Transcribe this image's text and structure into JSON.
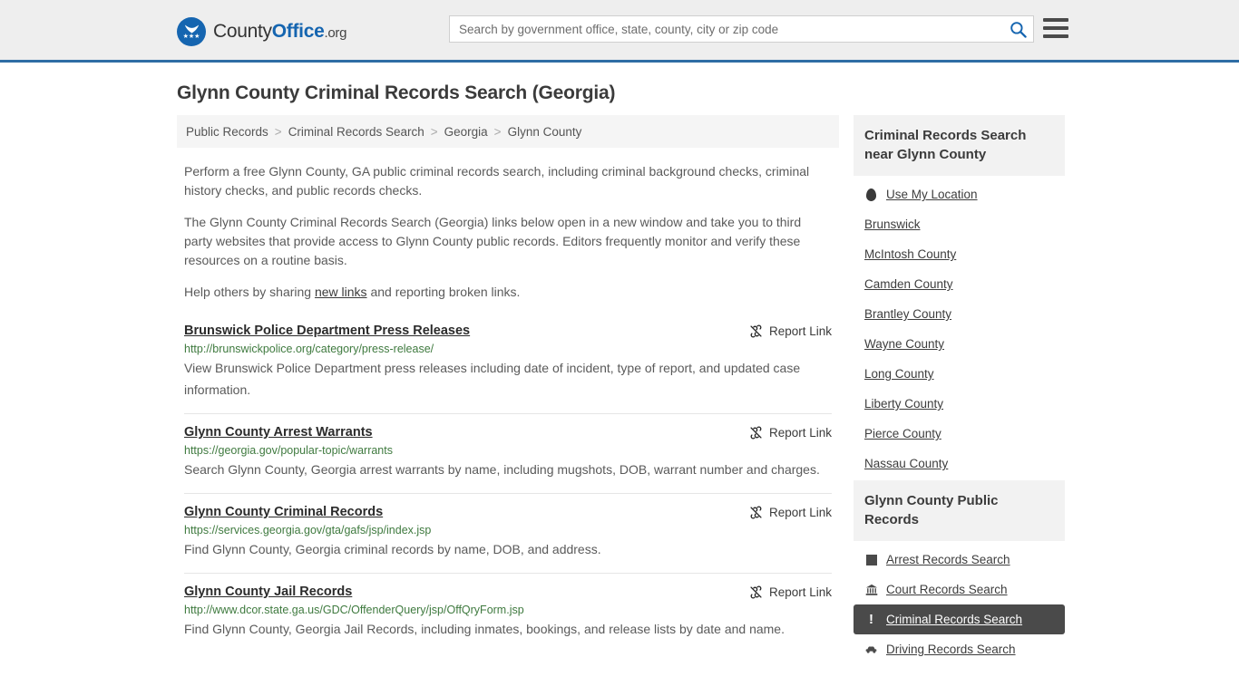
{
  "header": {
    "brand": {
      "part1": "County",
      "part2": "Office",
      "tld": ".org"
    },
    "search": {
      "placeholder": "Search by government office, state, county, city or zip code",
      "value": "",
      "button_label": "Search"
    },
    "menu_label": "Menu",
    "accent_color": "#2e6da4",
    "background_color": "#eeeeee"
  },
  "page": {
    "title": "Glynn County Criminal Records Search (Georgia)"
  },
  "breadcrumb": {
    "separator": ">",
    "items": [
      {
        "label": "Public Records"
      },
      {
        "label": "Criminal Records Search"
      },
      {
        "label": "Georgia"
      },
      {
        "label": "Glynn County"
      }
    ]
  },
  "intro": {
    "paragraph1": "Perform a free Glynn County, GA public criminal records search, including criminal background checks, criminal history checks, and public records checks.",
    "paragraph2": "The Glynn County Criminal Records Search (Georgia) links below open in a new window and take you to third party websites that provide access to Glynn County public records. Editors frequently monitor and verify these resources on a routine basis.",
    "paragraph3_before": "Help others by sharing ",
    "paragraph3_link": "new links",
    "paragraph3_after": " and reporting broken links."
  },
  "report_link_label": "Report Link",
  "records": [
    {
      "title": "Brunswick Police Department Press Releases",
      "url": "http://brunswickpolice.org/category/press-release/",
      "description": "View Brunswick Police Department press releases including date of incident, type of report, and updated case information."
    },
    {
      "title": "Glynn County Arrest Warrants",
      "url": "https://georgia.gov/popular-topic/warrants",
      "description": "Search Glynn County, Georgia arrest warrants by name, including mugshots, DOB, warrant number and charges."
    },
    {
      "title": "Glynn County Criminal Records",
      "url": "https://services.georgia.gov/gta/gafs/jsp/index.jsp",
      "description": "Find Glynn County, Georgia criminal records by name, DOB, and address."
    },
    {
      "title": "Glynn County Jail Records",
      "url": "http://www.dcor.state.ga.us/GDC/OffenderQuery/jsp/OffQryForm.jsp",
      "description": "Find Glynn County, Georgia Jail Records, including inmates, bookings, and release lists by date and name."
    }
  ],
  "sidebar": {
    "nearby": {
      "heading": "Criminal Records Search near Glynn County",
      "items": [
        {
          "label": "Use My Location",
          "icon": "map-pin-icon"
        },
        {
          "label": "Brunswick",
          "icon": ""
        },
        {
          "label": "McIntosh County",
          "icon": ""
        },
        {
          "label": "Camden County",
          "icon": ""
        },
        {
          "label": "Brantley County",
          "icon": ""
        },
        {
          "label": "Wayne County",
          "icon": ""
        },
        {
          "label": "Long County",
          "icon": ""
        },
        {
          "label": "Liberty County",
          "icon": ""
        },
        {
          "label": "Pierce County",
          "icon": ""
        },
        {
          "label": "Nassau County",
          "icon": ""
        }
      ]
    },
    "public_records": {
      "heading": "Glynn County Public Records",
      "items": [
        {
          "label": "Arrest Records Search",
          "icon": "square-icon",
          "active": false
        },
        {
          "label": "Court Records Search",
          "icon": "courthouse-icon",
          "active": false
        },
        {
          "label": "Criminal Records Search",
          "icon": "exclamation-icon",
          "active": true
        },
        {
          "label": "Driving Records Search",
          "icon": "car-icon",
          "active": false
        }
      ],
      "active_background": "#4a4a4a"
    }
  }
}
